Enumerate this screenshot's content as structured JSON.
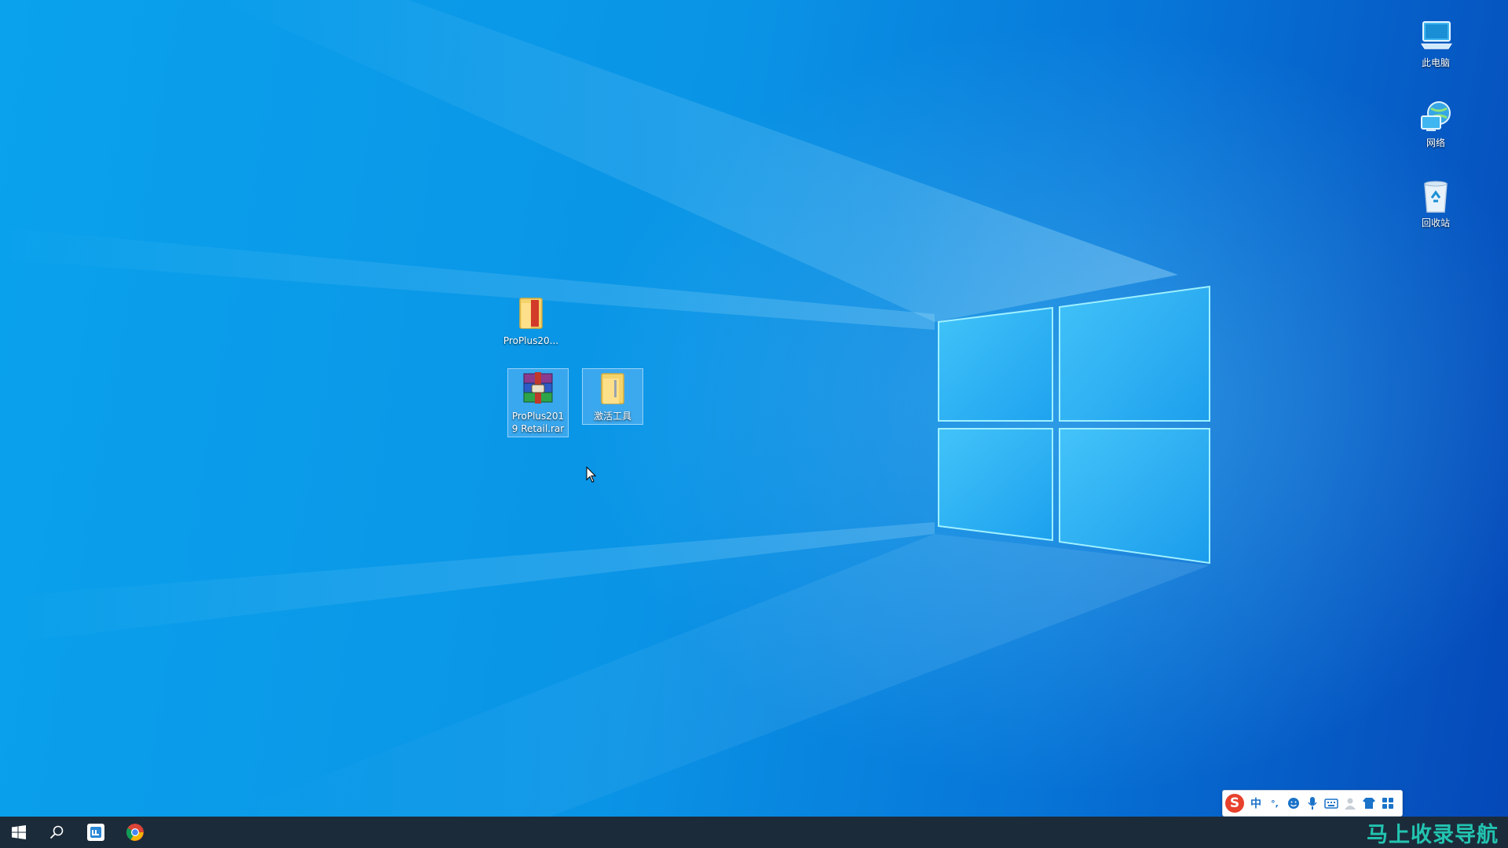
{
  "desktop": {
    "system_icons": [
      {
        "label": "此电脑",
        "icon": "this-pc-icon"
      },
      {
        "label": "网络",
        "icon": "network-icon"
      },
      {
        "label": "回收站",
        "icon": "recycle-bin-icon"
      }
    ],
    "files": [
      {
        "label": "ProPlus20...",
        "icon": "folder-icon",
        "selected": false
      },
      {
        "label": "ProPlus2019 Retail.rar",
        "icon": "winrar-archive-icon",
        "selected": true
      },
      {
        "label": "激活工具",
        "icon": "folder-icon",
        "selected": true
      }
    ]
  },
  "taskbar": {
    "items": [
      {
        "name": "start",
        "icon": "windows-start-icon"
      },
      {
        "name": "search",
        "icon": "search-icon"
      },
      {
        "name": "app",
        "icon": "app-icon"
      },
      {
        "name": "chrome",
        "icon": "chrome-icon"
      }
    ]
  },
  "ime": {
    "logo": "S",
    "mode": "中",
    "punct": "°,",
    "items": [
      "emoji-icon",
      "microphone-icon",
      "keyboard-icon",
      "user-icon",
      "skin-icon",
      "toolbox-icon"
    ]
  },
  "watermark": {
    "text": "马上收录导航"
  },
  "colors": {
    "desktop_left": "#0aa2ec",
    "desktop_right": "#0548b8",
    "taskbar": "#1c2b3a",
    "ime_accent": "#1a72c9",
    "sogou_red": "#e8412c",
    "watermark": "#22c4b0"
  }
}
